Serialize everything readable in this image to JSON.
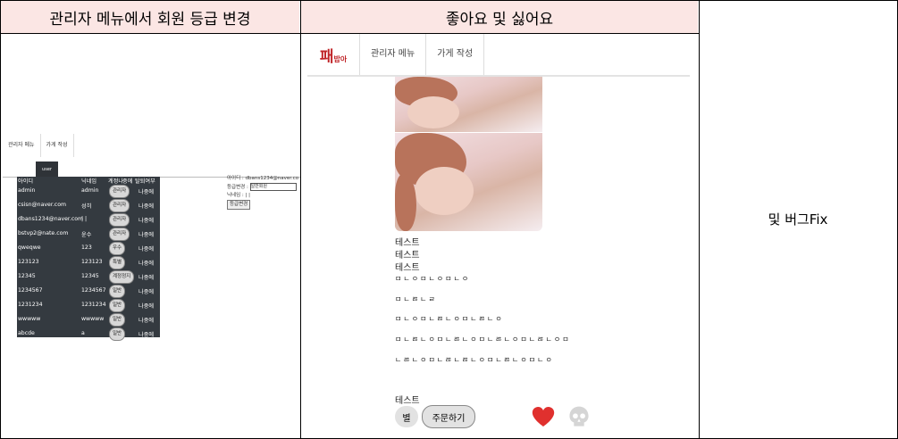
{
  "headers": {
    "col1": "관리자 메뉴에서 회원 등급 변경",
    "col2": "좋아요 및 싫어요",
    "col3": "및 버그Fix"
  },
  "panel1": {
    "nav": [
      "관리자 메뉴",
      "가게 작성"
    ],
    "tab_label": "user",
    "table_headers": [
      "아이디",
      "닉네임",
      "계정나",
      "중에",
      "탈퇴여부"
    ],
    "rows": [
      {
        "id": "admin",
        "nick": "admin",
        "grade": "관리자",
        "status": "나중에"
      },
      {
        "id": "csisn@naver.com",
        "nick": "성히",
        "grade": "관리자",
        "status": "나중에"
      },
      {
        "id": "dbans1234@naver.com",
        "nick": "| |",
        "grade": "관리자",
        "status": "나중에"
      },
      {
        "id": "bstvp2@nate.com",
        "nick": "윤수",
        "grade": "관리자",
        "status": "나중에"
      },
      {
        "id": "qweqwe",
        "nick": "123",
        "grade": "우수",
        "status": "나중에"
      },
      {
        "id": "123123",
        "nick": "123123",
        "grade": "특별",
        "status": "나중에"
      },
      {
        "id": "12345",
        "nick": "12345",
        "grade": "계정정지",
        "status": "나중에"
      },
      {
        "id": "1234567",
        "nick": "1234567",
        "grade": "일반",
        "status": "나중에"
      },
      {
        "id": "1231234",
        "nick": "1231234",
        "grade": "일반",
        "status": "나중에"
      },
      {
        "id": "wwwww",
        "nick": "wwwww",
        "grade": "일반",
        "status": "나중에"
      },
      {
        "id": "abcde",
        "nick": "a",
        "grade": "일반",
        "status": "나중에"
      }
    ],
    "form": {
      "id_line": "아이디 : dbans1234@naver.co",
      "grade_label": "등급변경 :",
      "grade_value": "일반회원",
      "nick_line": "닉네임 : | |",
      "submit": "등급변경"
    }
  },
  "panel2": {
    "logo": "패",
    "logo_sub": "밥아",
    "nav": [
      "관리자 메뉴",
      "가게 작성"
    ],
    "texts": [
      "테스트",
      "테스트",
      "테스트"
    ],
    "jamo": [
      "ㅁㄴㅇㅁㄴㅇㅁㄴㅇ",
      "ㅁㄴㅀㄴㄹ",
      "ㅁㄴㅇㅁㄴㅀㄴㅇㅁㄴㅀㄴㅇ",
      "ㅁㄴㅀㄴㅇㅁㄴㅀㄴㅇㅁㄴㅀㄴㅇㅁㄴㅀㄴㅇㅁ",
      "ㄴㅀㄴㅇㅁㄴㅀㄴㅀㄴㅇㅁㄴㅀㄴㅇㅁㄴㅇ"
    ],
    "text_bottom": "테스트",
    "star_btn": "별",
    "order_btn": "주문하기",
    "heart_color": "#e0302e",
    "skull_color": "#d5d5d5"
  }
}
